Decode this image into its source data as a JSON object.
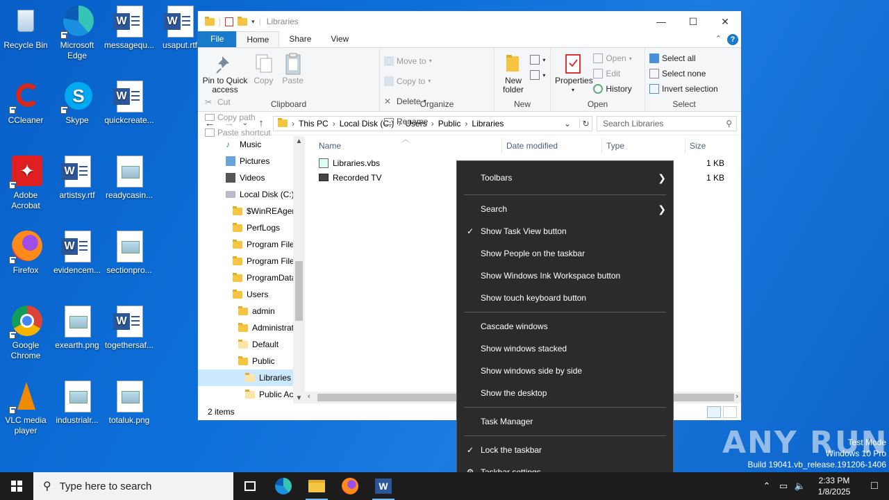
{
  "desktop": {
    "icons": [
      {
        "label": "Recycle Bin"
      },
      {
        "label": "Microsoft Edge"
      },
      {
        "label": "messagequ..."
      },
      {
        "label": "usaput.rtf"
      },
      {
        "label": "CCleaner"
      },
      {
        "label": "Skype"
      },
      {
        "label": "quickcreate..."
      },
      {
        "label": "Adobe Acrobat"
      },
      {
        "label": "artistsy.rtf"
      },
      {
        "label": "readycasin..."
      },
      {
        "label": "Firefox"
      },
      {
        "label": "evidencem..."
      },
      {
        "label": "sectionpro..."
      },
      {
        "label": "Google Chrome"
      },
      {
        "label": "exearth.png"
      },
      {
        "label": "togethersaf..."
      },
      {
        "label": "VLC media player"
      },
      {
        "label": "industrialr..."
      },
      {
        "label": "totaluk.png"
      }
    ]
  },
  "explorer": {
    "title": "Libraries",
    "tabs": {
      "file": "File",
      "home": "Home",
      "share": "Share",
      "view": "View",
      "help": "?"
    },
    "ribbon": {
      "clipboard": {
        "name": "Clipboard",
        "pin": "Pin to Quick access",
        "copy": "Copy",
        "paste": "Paste",
        "cut": "Cut",
        "copy_path": "Copy path",
        "paste_shortcut": "Paste shortcut"
      },
      "organize": {
        "name": "Organize",
        "move_to": "Move to",
        "copy_to": "Copy to",
        "delete": "Delete",
        "rename": "Rename"
      },
      "new": {
        "name": "New",
        "new_folder": "New folder"
      },
      "open": {
        "name": "Open",
        "properties": "Properties",
        "open": "Open",
        "edit": "Edit",
        "history": "History"
      },
      "select": {
        "name": "Select",
        "select_all": "Select all",
        "select_none": "Select none",
        "invert": "Invert selection"
      }
    },
    "address": {
      "crumbs": [
        "This PC",
        "Local Disk (C:)",
        "Users",
        "Public",
        "Libraries"
      ],
      "search_placeholder": "Search Libraries"
    },
    "nav_items": [
      {
        "label": "Music",
        "indent": 1
      },
      {
        "label": "Pictures",
        "indent": 1
      },
      {
        "label": "Videos",
        "indent": 1
      },
      {
        "label": "Local Disk (C:)",
        "indent": 1
      },
      {
        "label": "$WinREAgent",
        "indent": 2
      },
      {
        "label": "PerfLogs",
        "indent": 2
      },
      {
        "label": "Program Files",
        "indent": 2
      },
      {
        "label": "Program Files",
        "indent": 2
      },
      {
        "label": "ProgramData",
        "indent": 2
      },
      {
        "label": "Users",
        "indent": 2
      },
      {
        "label": "admin",
        "indent": 3
      },
      {
        "label": "Administrat",
        "indent": 3
      },
      {
        "label": "Default",
        "indent": 3
      },
      {
        "label": "Public",
        "indent": 3
      },
      {
        "label": "Libraries",
        "indent": 4,
        "selected": true
      },
      {
        "label": "Public Acc",
        "indent": 4
      }
    ],
    "columns": {
      "name": "Name",
      "date": "Date modified",
      "type": "Type",
      "size": "Size"
    },
    "files": [
      {
        "name": "Libraries.vbs",
        "size": "1 KB"
      },
      {
        "name": "Recorded TV",
        "size": "1 KB"
      }
    ],
    "status": "2 items"
  },
  "context_menu": {
    "items": [
      {
        "label": "Toolbars",
        "submenu": true
      },
      {
        "label": "Search",
        "submenu": true
      },
      {
        "label": "Show Task View button",
        "checked": true
      },
      {
        "label": "Show People on the taskbar"
      },
      {
        "label": "Show Windows Ink Workspace button"
      },
      {
        "label": "Show touch keyboard button"
      },
      {
        "label": "Cascade windows"
      },
      {
        "label": "Show windows stacked"
      },
      {
        "label": "Show windows side by side"
      },
      {
        "label": "Show the desktop"
      },
      {
        "label": "Task Manager"
      },
      {
        "label": "Lock the taskbar",
        "checked": true
      },
      {
        "label": "Taskbar settings"
      }
    ]
  },
  "watermark": {
    "brand": "ANY RUN",
    "line1": "Test Mode",
    "line2": "Windows 10 Pro",
    "line3": "Build 19041.vb_release.191206-1406"
  },
  "taskbar": {
    "search_placeholder": "Type here to search",
    "time": "2:33 PM",
    "date": "1/8/2025"
  }
}
